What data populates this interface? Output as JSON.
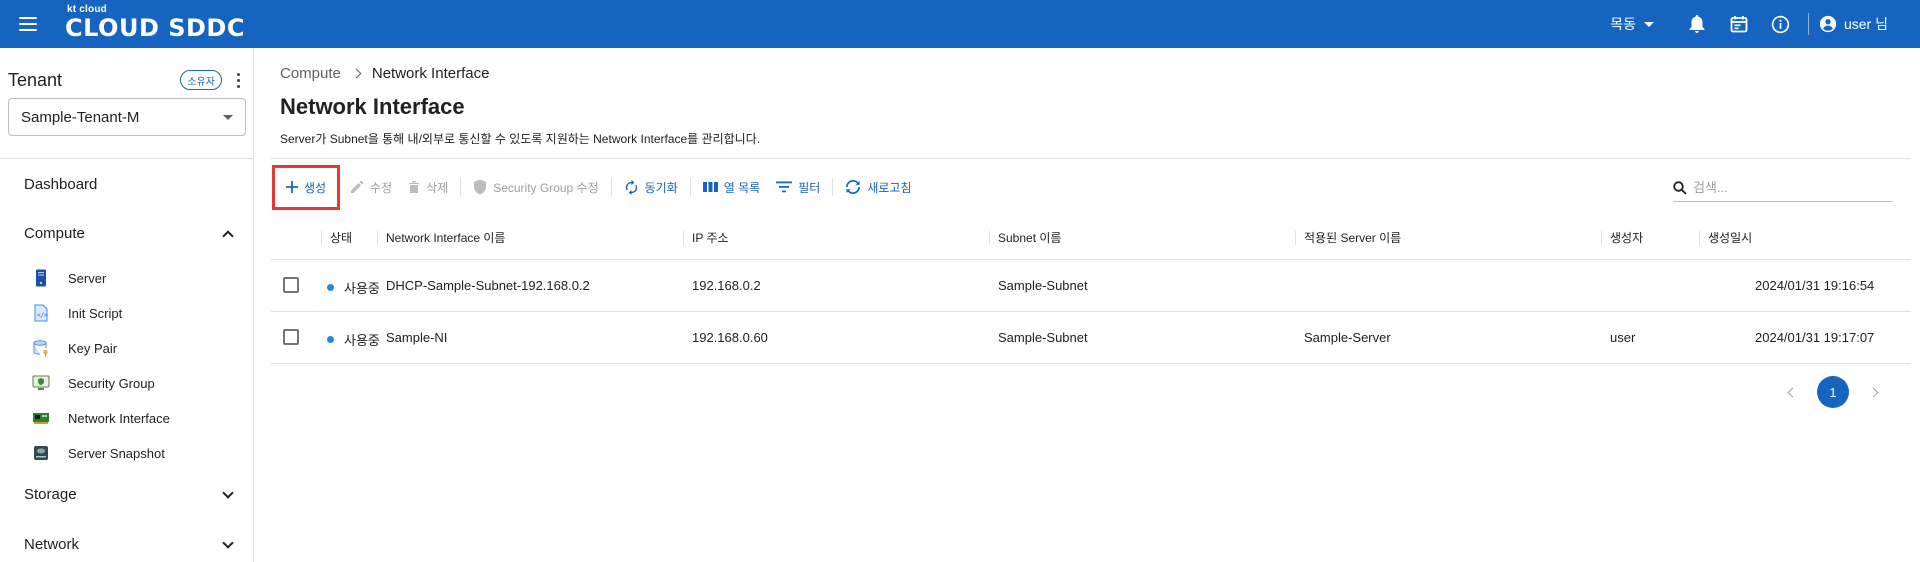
{
  "header": {
    "brand_small": "kt cloud",
    "brand_big": "CLOUD SDDC",
    "catalog_label": "목동",
    "user_label": "user 님"
  },
  "sidebar": {
    "tenant_title": "Tenant",
    "owner_badge": "소유자",
    "tenant_select_value": "Sample-Tenant-M",
    "dashboard": "Dashboard",
    "compute": "Compute",
    "compute_items": [
      {
        "label": "Server",
        "icon": "server-icon"
      },
      {
        "label": "Init Script",
        "icon": "script-icon"
      },
      {
        "label": "Key Pair",
        "icon": "key-pair-icon"
      },
      {
        "label": "Security Group",
        "icon": "security-group-icon"
      },
      {
        "label": "Network Interface",
        "icon": "network-card-icon"
      },
      {
        "label": "Server Snapshot",
        "icon": "snapshot-icon"
      }
    ],
    "storage": "Storage",
    "network": "Network"
  },
  "main": {
    "breadcrumb": [
      "Compute",
      "Network Interface"
    ],
    "title": "Network Interface",
    "description": "Server가 Subnet을 통해 내/외부로 통신할 수 있도록 지원하는 Network Interface를 관리합니다.",
    "toolbar": {
      "create": "생성",
      "edit": "수정",
      "delete": "삭제",
      "edit_sg": "Security Group 수정",
      "sync": "동기화",
      "columns": "열 목록",
      "filter": "필터",
      "refresh": "새로고침"
    },
    "search_placeholder": "검색...",
    "table": {
      "headers": [
        "상태",
        "Network Interface 이름",
        "IP 주소",
        "Subnet 이름",
        "적용된 Server 이름",
        "생성자",
        "생성일시"
      ],
      "rows": [
        {
          "status": "사용중",
          "name": "DHCP-Sample-Subnet-192.168.0.2",
          "ip": "192.168.0.2",
          "subnet": "Sample-Subnet",
          "server": "",
          "creator": "",
          "created": "2024/01/31 19:16:54"
        },
        {
          "status": "사용중",
          "name": "Sample-NI",
          "ip": "192.168.0.60",
          "subnet": "Sample-Subnet",
          "server": "Sample-Server",
          "creator": "user",
          "created": "2024/01/31 19:17:07"
        }
      ]
    },
    "pagination": {
      "current": "1"
    }
  },
  "colors": {
    "primary": "#1565c0",
    "highlight": "#e53935",
    "status_active": "#1e88e5"
  }
}
